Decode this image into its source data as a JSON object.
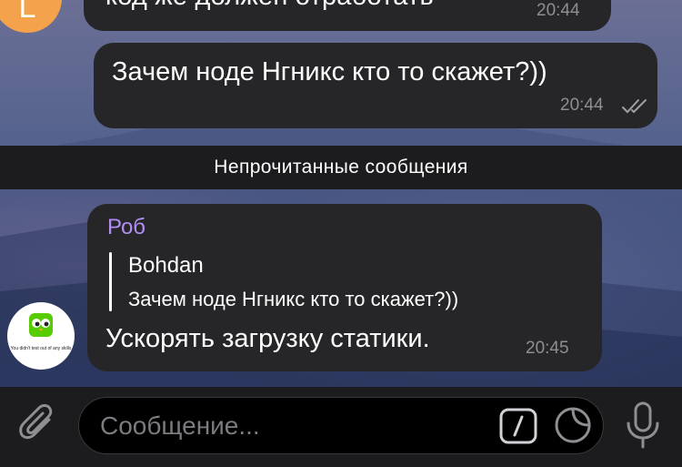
{
  "messages": [
    {
      "text": "код же должен отработать",
      "time": "20:44",
      "incoming": true,
      "avatar_letter": "L"
    },
    {
      "text": "Зачем ноде Нгникс кто то скажет?))",
      "time": "20:44",
      "incoming": false,
      "read": true
    }
  ],
  "divider": "Непрочитанные сообщения",
  "reply_message": {
    "sender": "Роб",
    "reply_to_name": "Bohdan",
    "reply_to_text": "Зачем ноде Нгникс кто то скажет?))",
    "text": "Ускорять загрузку статики.",
    "time": "20:45",
    "avatar_caption": "You didn't test out of any skills"
  },
  "input": {
    "placeholder": "Сообщение..."
  },
  "colors": {
    "sender": "#b18ef3",
    "bubble": "#262628",
    "avatar_top": "#f4a24b"
  },
  "icons": [
    "paperclip-icon",
    "bot-command-icon",
    "sticker-icon",
    "microphone-icon",
    "double-check-icon"
  ]
}
